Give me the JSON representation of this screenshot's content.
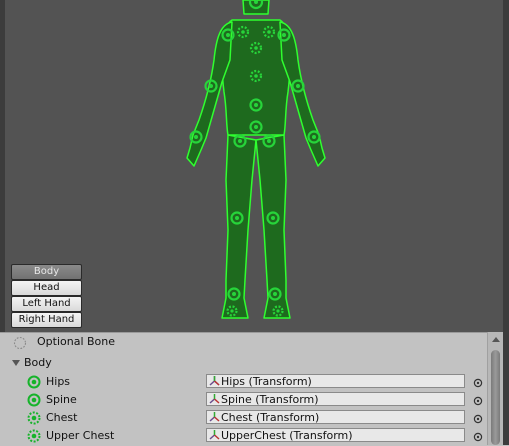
{
  "view_buttons": {
    "body": "Body",
    "head": "Head",
    "left_hand": "Left Hand",
    "right_hand": "Right Hand"
  },
  "legend": {
    "optional_bone": "Optional Bone"
  },
  "section": {
    "title": "Body"
  },
  "bones": [
    {
      "label": "Hips",
      "value": "Hips (Transform)"
    },
    {
      "label": "Spine",
      "value": "Spine (Transform)"
    },
    {
      "label": "Chest",
      "value": "Chest (Transform)"
    },
    {
      "label": "Upper Chest",
      "value": "UpperChest (Transform)"
    }
  ],
  "colors": {
    "preview_bg": "#535353",
    "body_fill": "#1e6a1e",
    "body_stroke": "#2fff2f",
    "bone_green": "#27c43a",
    "panel_bg": "#c2c2c2"
  },
  "icons": {
    "required_bone": "solid-circle-icon",
    "optional_bone": "dashed-circle-icon",
    "transform": "transform-icon",
    "picker": "object-picker-icon"
  }
}
